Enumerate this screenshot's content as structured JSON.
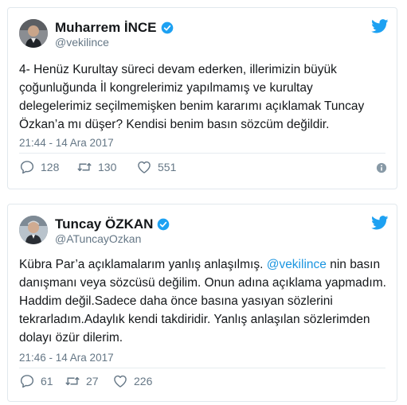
{
  "tweets": [
    {
      "author_name": "Muharrem İNCE",
      "handle": "@vekilince",
      "text": "4- Henüz Kurultay süreci devam ederken, illerimizin büyük çoğunluğunda İl kongrelerimiz yapılmamış ve kurultay delegelerimiz seçilmemişken benim kararımı açıklamak Tuncay Özkan’a mı düşer? Kendisi benim basın sözcüm değildir.",
      "timestamp": "21:44 - 14 Ara 2017",
      "replies": "128",
      "retweets": "130",
      "likes": "551"
    },
    {
      "author_name": "Tuncay ÖZKAN",
      "handle": "@ATuncayOzkan",
      "text_before_mention": "Kübra Par’a açıklamalarım yanlış anlaşılmış. ",
      "mention": "@vekilince",
      "text_after_mention": " nin basın danışmanı veya sözcüsü değilim. Onun adına açıklama yapmadım. Haddim değil.Sadece daha önce basına yasıyan sözlerini tekrarladım.Adaylık kendi takdiridir. Yanlış anlaşılan sözlerimden dolayı özür dilerim.",
      "timestamp": "21:46 - 14 Ara 2017",
      "replies": "61",
      "retweets": "27",
      "likes": "226"
    }
  ],
  "icons": {
    "bird": "twitter-bird-icon",
    "verified": "verified-badge-icon",
    "reply": "reply-icon",
    "retweet": "retweet-icon",
    "like": "heart-icon",
    "info": "info-icon"
  },
  "colors": {
    "brand_blue": "#1da1f2",
    "mention_blue": "#1b95e0",
    "muted_text": "#657786",
    "border": "#e1e8ed"
  }
}
